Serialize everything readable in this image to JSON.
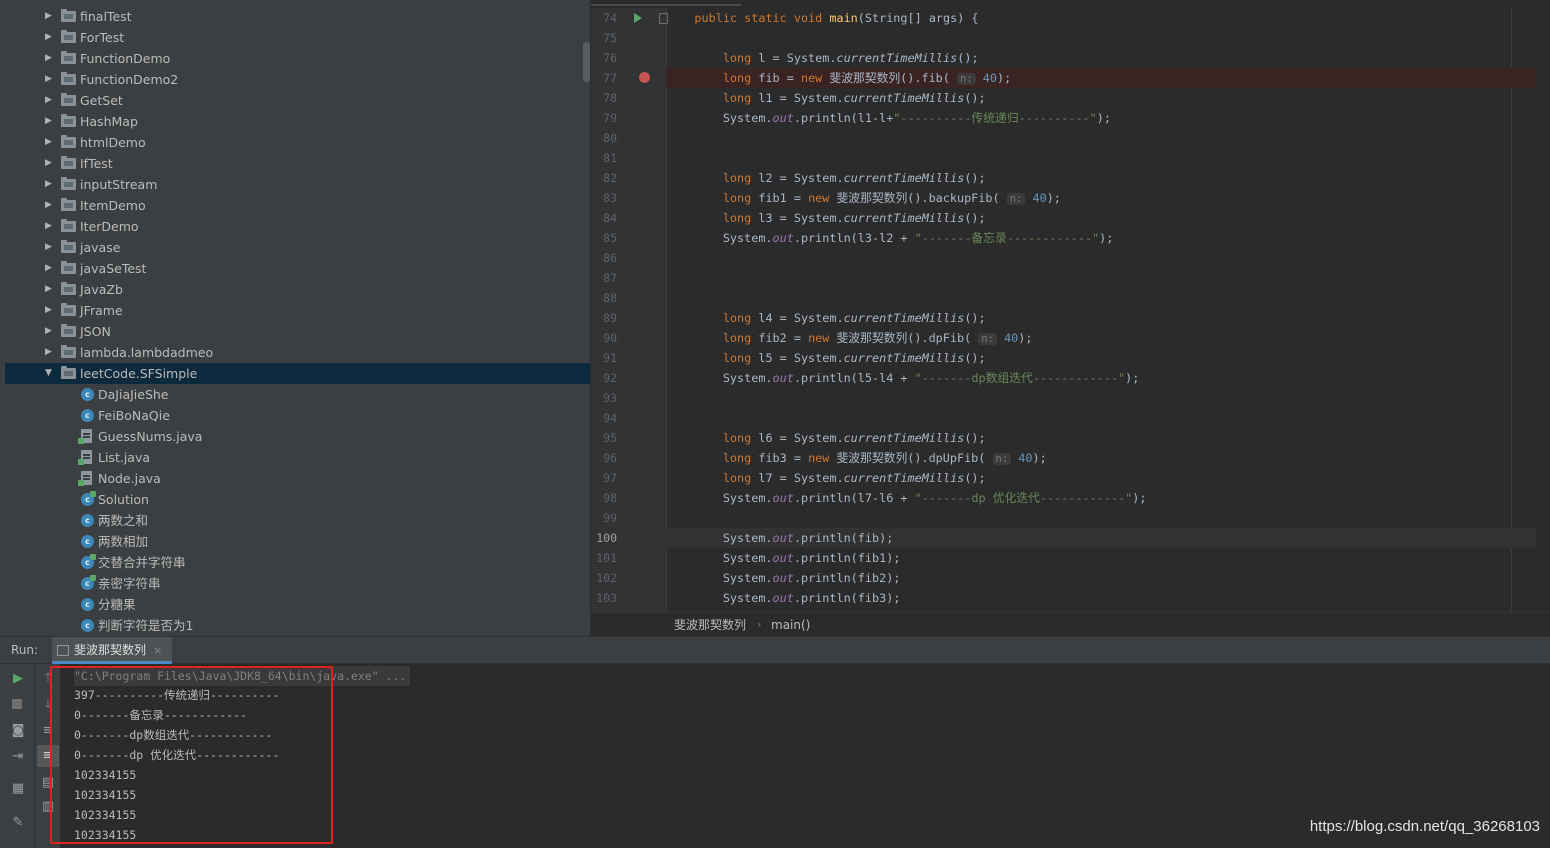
{
  "project_tree": {
    "folders": [
      {
        "label": "finalTest"
      },
      {
        "label": "ForTest"
      },
      {
        "label": "FunctionDemo"
      },
      {
        "label": "FunctionDemo2"
      },
      {
        "label": "GetSet"
      },
      {
        "label": "HashMap"
      },
      {
        "label": "htmlDemo"
      },
      {
        "label": "IfTest"
      },
      {
        "label": "inputStream"
      },
      {
        "label": "ItemDemo"
      },
      {
        "label": "IterDemo"
      },
      {
        "label": "javase"
      },
      {
        "label": "javaSeTest"
      },
      {
        "label": "JavaZb"
      },
      {
        "label": "JFrame"
      },
      {
        "label": "JSON"
      },
      {
        "label": "lambda.lambdadmeo"
      },
      {
        "label": "leetCode.SFSimple"
      }
    ],
    "children": [
      {
        "label": "DaJiaJieShe",
        "icon": "class-icon"
      },
      {
        "label": "FeiBoNaQie",
        "icon": "class-icon"
      },
      {
        "label": "GuessNums.java",
        "icon": "java-file-icon"
      },
      {
        "label": "List.java",
        "icon": "java-file-icon"
      },
      {
        "label": "Node.java",
        "icon": "java-file-icon"
      },
      {
        "label": "Solution",
        "icon": "class-icon"
      },
      {
        "label": "两数之和",
        "icon": "class-icon"
      },
      {
        "label": "两数相加",
        "icon": "class-icon"
      },
      {
        "label": "交替合并字符串",
        "icon": "class-icon"
      },
      {
        "label": "亲密字符串",
        "icon": "class-icon"
      },
      {
        "label": "分糖果",
        "icon": "class-icon"
      },
      {
        "label": "判断字符是否为1",
        "icon": "class-icon"
      }
    ],
    "selected": "leetCode.SFSimple"
  },
  "editor": {
    "line_numbers": [
      "74",
      "75",
      "76",
      "77",
      "78",
      "79",
      "80",
      "81",
      "82",
      "83",
      "84",
      "85",
      "86",
      "87",
      "88",
      "89",
      "90",
      "91",
      "92",
      "93",
      "94",
      "95",
      "96",
      "97",
      "98",
      "99",
      "100",
      "101",
      "102",
      "103"
    ],
    "current_line": "100",
    "breakpoint_line": "77",
    "code": {
      "l74": "public static void main(String[] args) {",
      "l76": "long l = System.currentTimeMillis();",
      "l77": "long fib = new 斐波那契数列().fib( n: 40);",
      "l78": "long l1 = System.currentTimeMillis();",
      "l79": "System.out.println(l1-l+\"----------传统递归----------\");",
      "l82": "long l2 = System.currentTimeMillis();",
      "l83": "long fib1 = new 斐波那契数列().backupFib( n: 40);",
      "l84": "long l3 = System.currentTimeMillis();",
      "l85": "System.out.println(l3-l2 + \"-------备忘录------------\");",
      "l89": "long l4 = System.currentTimeMillis();",
      "l90": "long fib2 = new 斐波那契数列().dpFib( n: 40);",
      "l91": "long l5 = System.currentTimeMillis();",
      "l92": "System.out.println(l5-l4 + \"-------dp数组迭代------------\");",
      "l95": "long l6 = System.currentTimeMillis();",
      "l96": "long fib3 = new 斐波那契数列().dpUpFib( n: 40);",
      "l97": "long l7 = System.currentTimeMillis();",
      "l98": "System.out.println(l7-l6 + \"-------dp 优化迭代------------\");",
      "l100": "System.out.println(fib);",
      "l101": "System.out.println(fib1);",
      "l102": "System.out.println(fib2);",
      "l103": "System.out.println(fib3);"
    },
    "breadcrumb": {
      "class_name": "斐波那契数列",
      "separator": "›",
      "method": "main()"
    }
  },
  "run_panel": {
    "label": "Run:",
    "tab_name": "斐波那契数列",
    "tab_close": "×",
    "console_lines": [
      "\"C:\\Program Files\\Java\\JDK8_64\\bin\\java.exe\" ...",
      "397----------传统递归----------",
      "0-------备忘录------------",
      "0-------dp数组迭代------------",
      "0-------dp 优化迭代------------",
      "102334155",
      "102334155",
      "102334155",
      "102334155"
    ],
    "highlight_color": "#e0231e"
  },
  "watermark": "https://blog.csdn.net/qq_36268103",
  "colors": {
    "keyword": "#cc7832",
    "method": "#ffc66d",
    "static_field": "#9876aa",
    "string": "#6a8759",
    "background": "#2b2b2b",
    "panel": "#3c3f41",
    "selection": "#0d293e",
    "breakpoint": "#c75450"
  }
}
